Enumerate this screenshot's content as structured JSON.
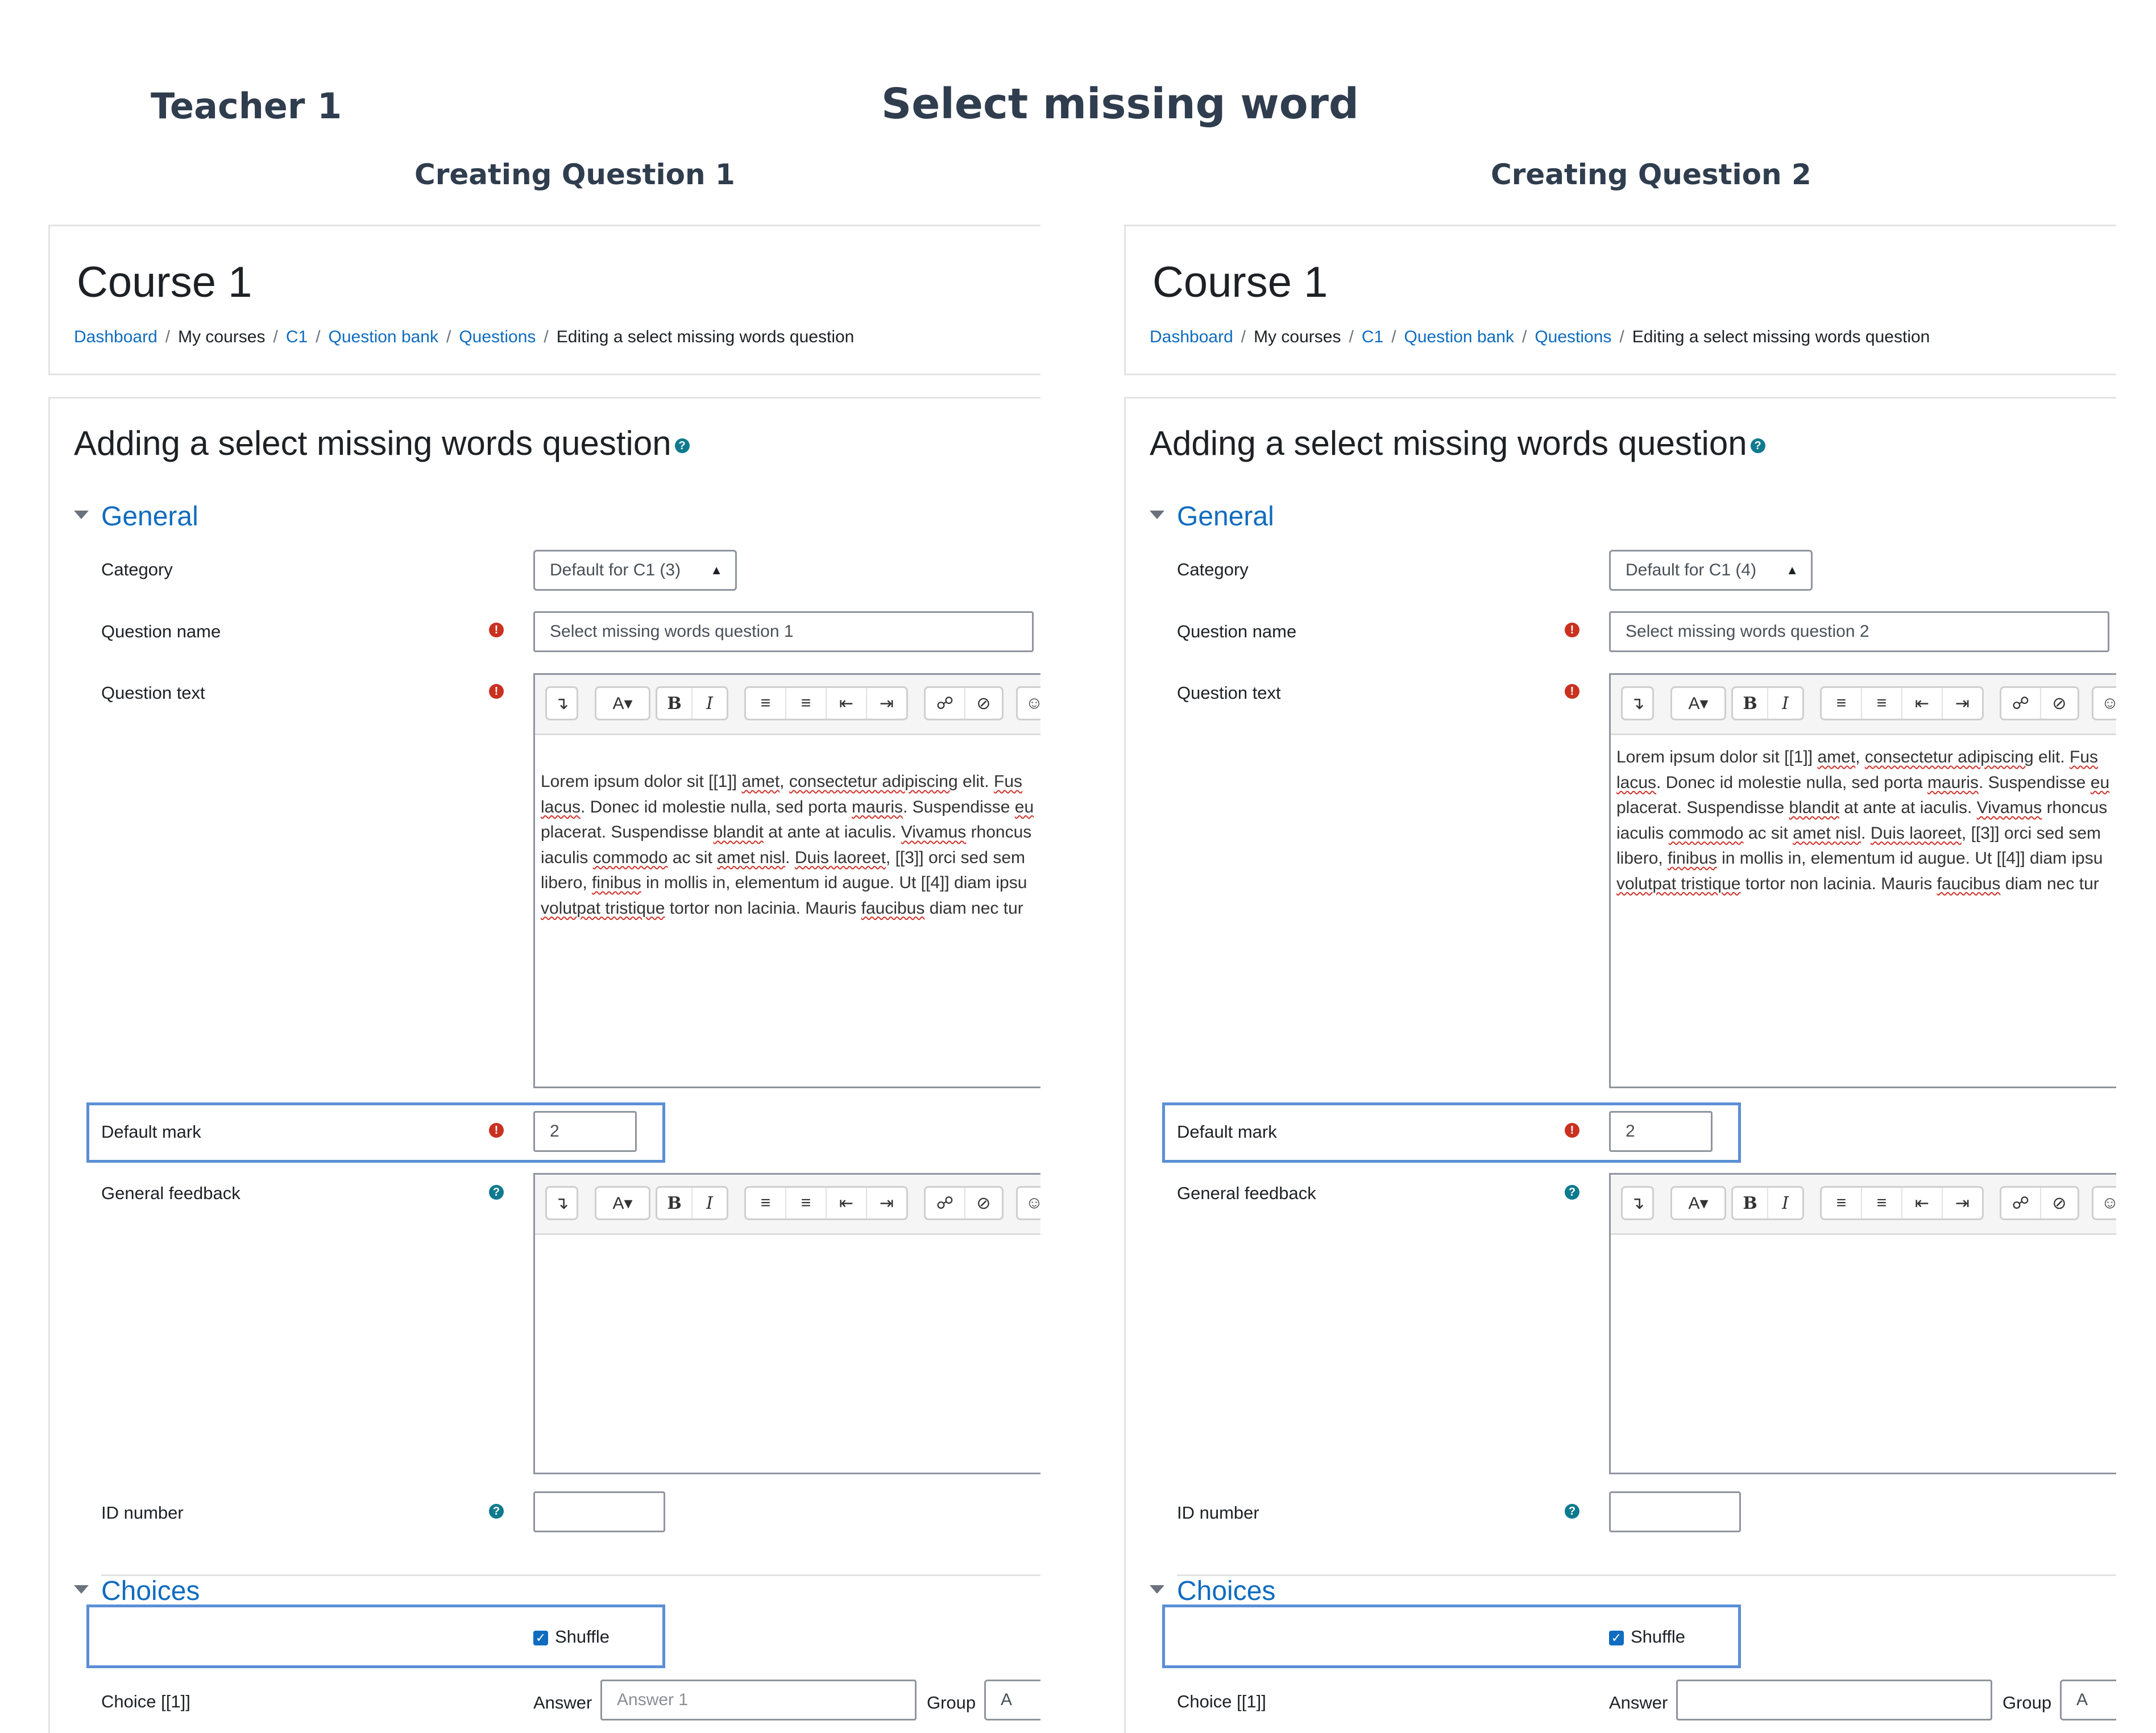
{
  "header": {
    "teacher": "Teacher 1",
    "title": "Select missing word",
    "subtitles": [
      "Creating Question 1",
      "Creating Question 2"
    ]
  },
  "panels": [
    {
      "course_title": "Course 1",
      "breadcrumb": [
        "Dashboard",
        "My courses",
        "C1",
        "Question bank",
        "Questions",
        "Editing a select missing words question"
      ],
      "form_heading": "Adding a select missing words question",
      "general_label": "General",
      "category_label": "Category",
      "category_value": "Default for C1 (3)",
      "question_name_label": "Question name",
      "question_name_value": "Select missing words question 1",
      "question_text_label": "Question text",
      "question_text_lines": [
        [
          "Lorem ipsum dolor sit [[1]] ",
          {
            "sq": "amet"
          },
          ", ",
          {
            "sq": "consectetur adipiscing"
          },
          " elit. ",
          {
            "sq": "Fus"
          }
        ],
        [
          {
            "sq": "lacus"
          },
          ". Donec id molestie nulla, sed porta ",
          {
            "sq": "mauris"
          },
          ". Suspendisse ",
          {
            "sq": "eu"
          }
        ],
        [
          "placerat. Suspendisse ",
          {
            "sq": "blandit"
          },
          " at ante at iaculis. ",
          {
            "sq": "Vivamus"
          },
          " rhoncus"
        ],
        [
          "iaculis ",
          {
            "sq": "commodo"
          },
          " ac sit ",
          {
            "sq": "amet nisl"
          },
          ". ",
          {
            "sq": "Duis laoreet"
          },
          ", [[3]] orci sed sem"
        ],
        [
          "libero, ",
          {
            "sq": "finibus"
          },
          " in mollis in, elementum id augue. Ut [[4]] diam ipsu"
        ],
        [
          {
            "sq": "volutpat tristique"
          },
          " tortor non lacinia. Mauris ",
          {
            "sq": "faucibus"
          },
          " diam nec tur"
        ]
      ],
      "default_mark_label": "Default mark",
      "default_mark_value": "2",
      "general_feedback_label": "General feedback",
      "id_number_label": "ID number",
      "id_number_value": "",
      "choices_label": "Choices",
      "shuffle_label": "Shuffle",
      "shuffle_checked": true,
      "choice_label": "Choice [[1]]",
      "answer_label": "Answer",
      "answer_placeholder": "Answer 1",
      "group_label": "Group",
      "group_value": "A"
    },
    {
      "course_title": "Course 1",
      "breadcrumb": [
        "Dashboard",
        "My courses",
        "C1",
        "Question bank",
        "Questions",
        "Editing a select missing words question"
      ],
      "form_heading": "Adding a select missing words question",
      "general_label": "General",
      "category_label": "Category",
      "category_value": "Default for C1 (4)",
      "question_name_label": "Question name",
      "question_name_value": "Select missing words question 2",
      "question_text_label": "Question text",
      "question_text_lines": [
        [
          "Lorem ipsum dolor sit [[1]] ",
          {
            "sq": "amet"
          },
          ", ",
          {
            "sq": "consectetur adipiscing"
          },
          " elit. ",
          {
            "sq": "Fus"
          }
        ],
        [
          {
            "sq": "lacus"
          },
          ". Donec id molestie nulla, sed porta ",
          {
            "sq": "mauris"
          },
          ". Suspendisse ",
          {
            "sq": "eu"
          }
        ],
        [
          "placerat. Suspendisse ",
          {
            "sq": "blandit"
          },
          " at ante at iaculis. ",
          {
            "sq": "Vivamus"
          },
          " rhoncus"
        ],
        [
          "iaculis ",
          {
            "sq": "commodo"
          },
          " ac sit ",
          {
            "sq": "amet nisl"
          },
          ". ",
          {
            "sq": "Duis laoreet"
          },
          ", [[3]] orci sed sem"
        ],
        [
          "libero, ",
          {
            "sq": "finibus"
          },
          " in mollis in, elementum id augue. Ut [[4]] diam ipsu"
        ],
        [
          {
            "sq": "volutpat tristique"
          },
          " tortor non lacinia. Mauris ",
          {
            "sq": "faucibus"
          },
          " diam nec tur"
        ]
      ],
      "default_mark_label": "Default mark",
      "default_mark_value": "2",
      "general_feedback_label": "General feedback",
      "id_number_label": "ID number",
      "id_number_value": "",
      "choices_label": "Choices",
      "shuffle_label": "Shuffle",
      "shuffle_checked": true,
      "choice_label": "Choice [[1]]",
      "answer_label": "Answer",
      "answer_placeholder": "",
      "group_label": "Group",
      "group_value": "A"
    }
  ],
  "toolbar_icons": [
    "collapse-icon",
    "font-color-icon",
    "bold-icon",
    "italic-icon",
    "unordered-list-icon",
    "ordered-list-icon",
    "outdent-icon",
    "indent-icon",
    "link-icon",
    "unlink-icon",
    "emoji-icon"
  ],
  "colors": {
    "link": "#0f6cbf",
    "required": "#ca3120",
    "help": "#0f7a8e",
    "highlight": "#5b8fd6",
    "heading": "#2f3d4e"
  }
}
